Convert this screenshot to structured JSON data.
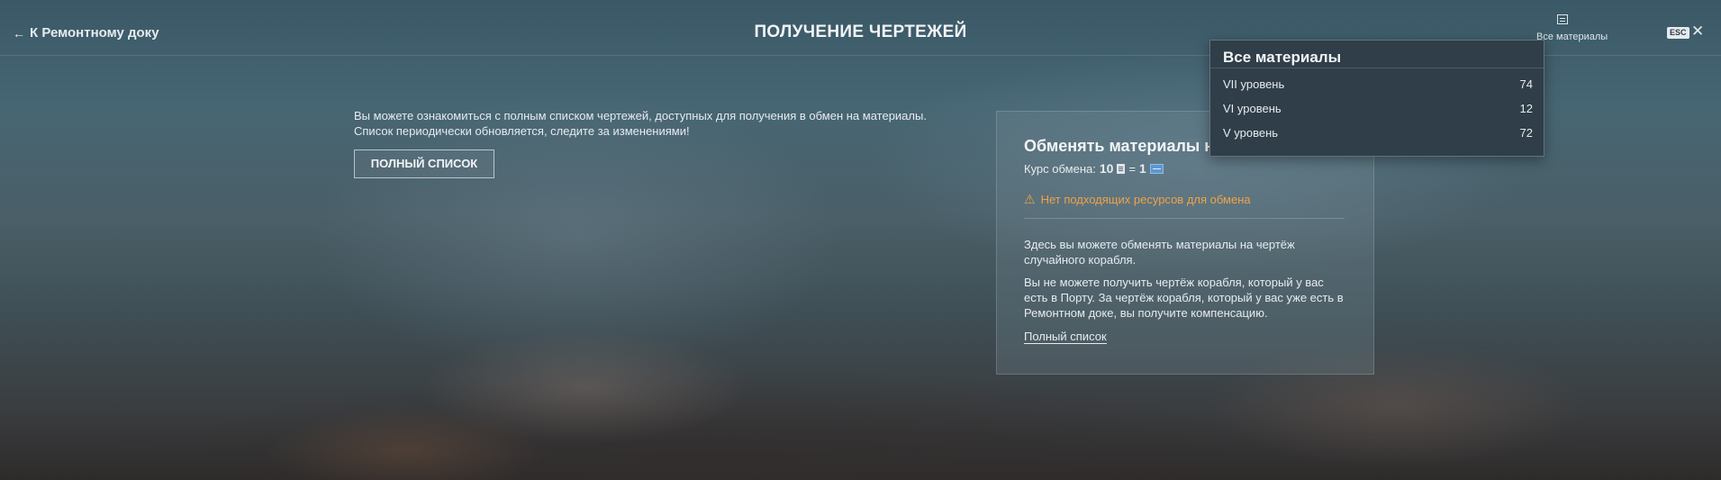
{
  "header": {
    "back_label": "К Ремонтному доку",
    "title": "ПОЛУЧЕНИЕ ЧЕРТЕЖЕЙ",
    "materials_label": "Все материалы",
    "esc_label": "ESC",
    "close_icon": "close-icon"
  },
  "intro": {
    "line1": "Вы можете ознакомиться с полным списком чертежей, доступных для получения в обмен на материалы.",
    "line2": "Список периодически обновляется, следите за изменениями!",
    "button_label": "ПОЛНЫЙ СПИСОК"
  },
  "exchange": {
    "title": "Обменять материалы на",
    "rate_label": "Курс обмена:",
    "rate_from": "10",
    "rate_equals": "=",
    "rate_to": "1",
    "warning": "Нет подходящих ресурсов для обмена",
    "text1": "Здесь вы можете обменять материалы на чертёж случайного корабля.",
    "text2": "Вы не можете получить чертёж корабля, который у вас есть в Порту. За чертёж корабля, который у вас уже есть в Ремонтном доке, вы получите компенсацию.",
    "link_label": "Полный список"
  },
  "materials_dropdown": {
    "title": "Все материалы",
    "items": [
      {
        "label": "VII уровень",
        "count": "74"
      },
      {
        "label": "VI уровень",
        "count": "12"
      },
      {
        "label": "V уровень",
        "count": "72"
      }
    ]
  },
  "colors": {
    "warning": "#f0a24a",
    "blueprint": "#5d97cf",
    "dropdown_bg": "#2f3e48"
  }
}
